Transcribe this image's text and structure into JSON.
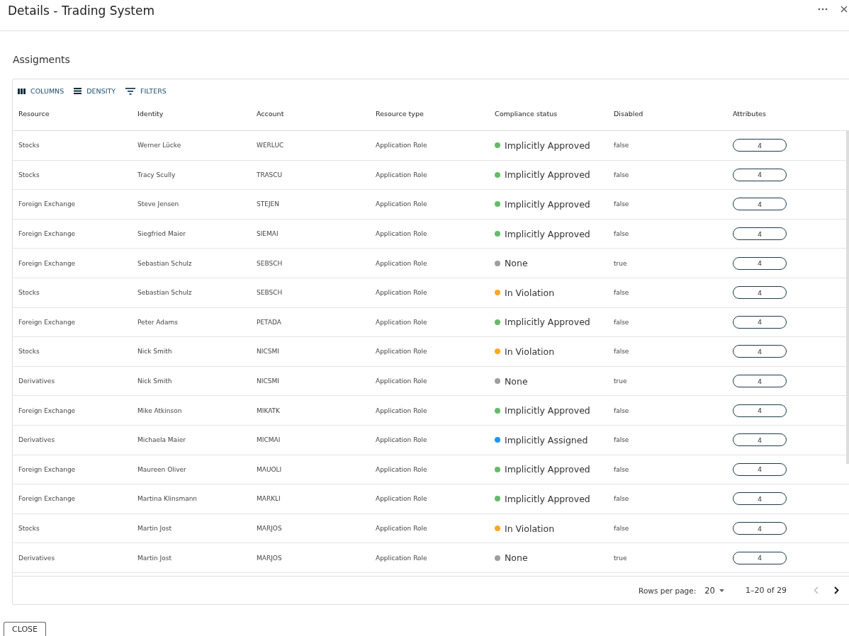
{
  "window": {
    "title": "Details - Trading System"
  },
  "section_title": "Assigments",
  "toolbar": [
    "COLUMNS",
    "DENSITY",
    "FILTERS"
  ],
  "table": {
    "columns": [
      "Resource",
      "Identity",
      "Account",
      "Resource type",
      "Compliance status",
      "Disabled",
      "Attributes"
    ],
    "rows": [
      {
        "resource": "Stocks",
        "identity": "Werner Lücke",
        "account": "WERLUC",
        "resource_type": "Application Role",
        "status": "Implicitly Approved",
        "color": "#66bb6a",
        "disabled": "false",
        "attributes": "4"
      },
      {
        "resource": "Stocks",
        "identity": "Tracy Scully",
        "account": "TRASCU",
        "resource_type": "Application Role",
        "status": "Implicitly Approved",
        "color": "#66bb6a",
        "disabled": "false",
        "attributes": "4"
      },
      {
        "resource": "Foreign Exchange",
        "identity": "Steve Jensen",
        "account": "STEJEN",
        "resource_type": "Application Role",
        "status": "Implicitly Approved",
        "color": "#66bb6a",
        "disabled": "false",
        "attributes": "4"
      },
      {
        "resource": "Foreign Exchange",
        "identity": "Siegfried Maier",
        "account": "SIEMAI",
        "resource_type": "Application Role",
        "status": "Implicitly Approved",
        "color": "#66bb6a",
        "disabled": "false",
        "attributes": "4"
      },
      {
        "resource": "Foreign Exchange",
        "identity": "Sebastian Schulz",
        "account": "SEBSCH",
        "resource_type": "Application Role",
        "status": "None",
        "color": "#9e9e9e",
        "disabled": "true",
        "attributes": "4"
      },
      {
        "resource": "Stocks",
        "identity": "Sebastian Schulz",
        "account": "SEBSCH",
        "resource_type": "Application Role",
        "status": "In Violation",
        "color": "#ffa726",
        "disabled": "false",
        "attributes": "4"
      },
      {
        "resource": "Foreign Exchange",
        "identity": "Peter Adams",
        "account": "PETADA",
        "resource_type": "Application Role",
        "status": "Implicitly Approved",
        "color": "#66bb6a",
        "disabled": "false",
        "attributes": "4"
      },
      {
        "resource": "Stocks",
        "identity": "Nick Smith",
        "account": "NICSMI",
        "resource_type": "Application Role",
        "status": "In Violation",
        "color": "#ffa726",
        "disabled": "false",
        "attributes": "4"
      },
      {
        "resource": "Derivatives",
        "identity": "Nick Smith",
        "account": "NICSMI",
        "resource_type": "Application Role",
        "status": "None",
        "color": "#9e9e9e",
        "disabled": "true",
        "attributes": "4"
      },
      {
        "resource": "Foreign Exchange",
        "identity": "Mike Atkinson",
        "account": "MIKATK",
        "resource_type": "Application Role",
        "status": "Implicitly Approved",
        "color": "#66bb6a",
        "disabled": "false",
        "attributes": "4"
      },
      {
        "resource": "Derivatives",
        "identity": "Michaela Maier",
        "account": "MICMAI",
        "resource_type": "Application Role",
        "status": "Implicitly Assigned",
        "color": "#2196f3",
        "disabled": "false",
        "attributes": "4"
      },
      {
        "resource": "Foreign Exchange",
        "identity": "Maureen Oliver",
        "account": "MAUOLI",
        "resource_type": "Application Role",
        "status": "Implicitly Approved",
        "color": "#66bb6a",
        "disabled": "false",
        "attributes": "4"
      },
      {
        "resource": "Foreign Exchange",
        "identity": "Martina Klinsmann",
        "account": "MARKLI",
        "resource_type": "Application Role",
        "status": "Implicitly Approved",
        "color": "#66bb6a",
        "disabled": "false",
        "attributes": "4"
      },
      {
        "resource": "Stocks",
        "identity": "Martin Jost",
        "account": "MARJOS",
        "resource_type": "Application Role",
        "status": "In Violation",
        "color": "#ffa726",
        "disabled": "false",
        "attributes": "4"
      },
      {
        "resource": "Derivatives",
        "identity": "Martin Jost",
        "account": "MARJOS",
        "resource_type": "Application Role",
        "status": "None",
        "color": "#9e9e9e",
        "disabled": "true",
        "attributes": "4"
      }
    ]
  },
  "pagination": {
    "rows_per_page_label": "Rows per page:",
    "rows_per_page": "20",
    "range": "1–20 of 29",
    "previous_disabled": true,
    "next_disabled": false
  },
  "buttons": [
    "CLOSE"
  ]
}
